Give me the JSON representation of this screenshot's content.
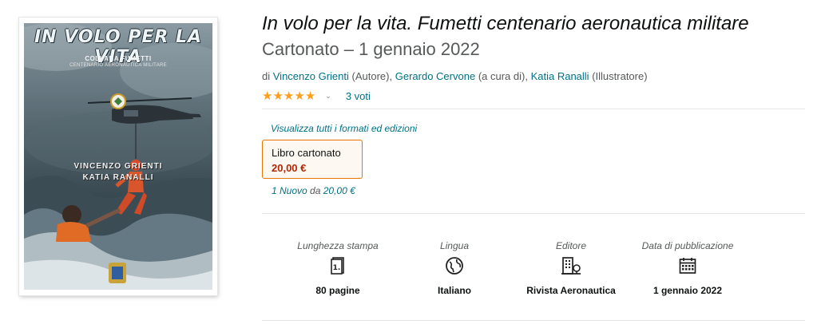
{
  "cover": {
    "title": "IN VOLO PER LA VITA",
    "series": "COLLANA FUMETTI",
    "subtitle": "CENTENARIO AERONAUTICA MILITARE",
    "author": "VINCENZO GRIENTI",
    "illustrator": "KATIA RANALLI"
  },
  "product": {
    "title": "In volo per la vita. Fumetti centenario aeronautica militare",
    "binding_date": "Cartonato – 1 gennaio 2022"
  },
  "byline": {
    "prefix": "di",
    "contributors": [
      {
        "name": "Vincenzo Grienti",
        "role": "(Autore),"
      },
      {
        "name": "Gerardo Cervone",
        "role": "(a cura di),"
      },
      {
        "name": "Katia Ranalli",
        "role": "(Illustratore)"
      }
    ]
  },
  "rating": {
    "stars": 5,
    "votes": "3 voti",
    "color": "#ff9e1b"
  },
  "formats": {
    "link": "Visualizza tutti i formati ed edizioni",
    "selected": {
      "label": "Libro cartonato",
      "price": "20,00 €"
    },
    "offers": {
      "count": "1 Nuovo",
      "from": "da",
      "price": "20,00 €"
    }
  },
  "specs": [
    {
      "label": "Lunghezza stampa",
      "icon": "page-count-icon",
      "value": "80 pagine"
    },
    {
      "label": "Lingua",
      "icon": "globe-icon",
      "value": "Italiano"
    },
    {
      "label": "Editore",
      "icon": "publisher-building-icon",
      "value": "Rivista Aeronautica"
    },
    {
      "label": "Data di pubblicazione",
      "icon": "calendar-icon",
      "value": "1 gennaio 2022"
    }
  ],
  "colors": {
    "link": "#007185",
    "price": "#b12704",
    "selected_border": "#e77600"
  }
}
